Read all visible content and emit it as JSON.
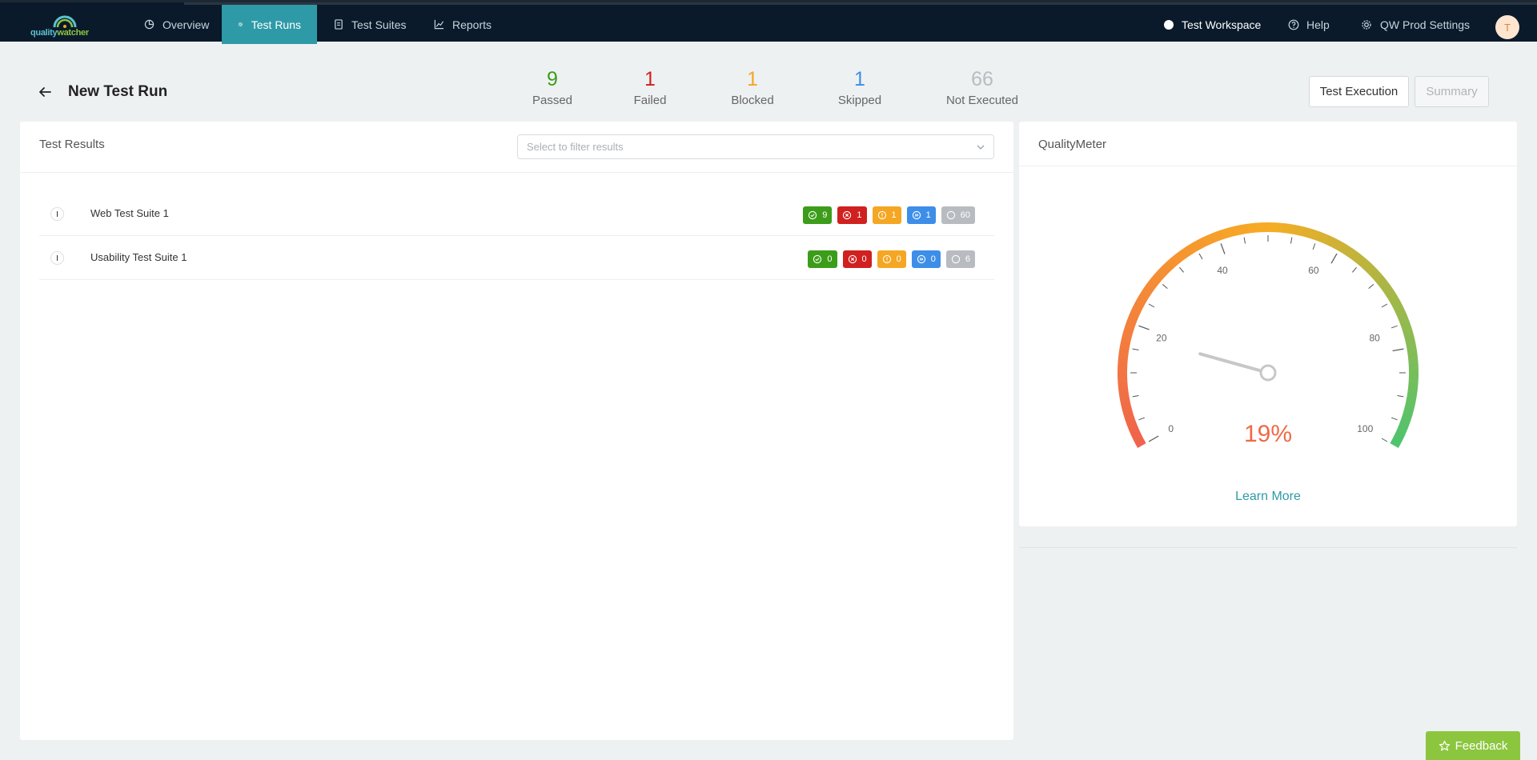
{
  "app": {
    "logo_quality": "quality",
    "logo_watcher": "watcher"
  },
  "nav": {
    "items": [
      {
        "label": "Overview",
        "icon": "pie-chart-icon"
      },
      {
        "label": "Test Runs",
        "icon": "gear-icon",
        "active": true
      },
      {
        "label": "Test Suites",
        "icon": "document-icon"
      },
      {
        "label": "Reports",
        "icon": "line-chart-icon"
      }
    ],
    "workspace": "Test Workspace",
    "help": "Help",
    "settings": "QW Prod Settings",
    "avatar_initial": "T"
  },
  "header": {
    "title": "New Test Run",
    "stats": [
      {
        "value": "9",
        "label": "Passed",
        "color": "#3c9d1a"
      },
      {
        "value": "1",
        "label": "Failed",
        "color": "#d0201f"
      },
      {
        "value": "1",
        "label": "Blocked",
        "color": "#f5a623"
      },
      {
        "value": "1",
        "label": "Skipped",
        "color": "#3d8ee8"
      },
      {
        "value": "66",
        "label": "Not Executed",
        "color": "#b8bcc0"
      }
    ],
    "btn_execution": "Test Execution",
    "btn_summary": "Summary"
  },
  "results": {
    "title": "Test Results",
    "filter_placeholder": "Select to filter results",
    "rows": [
      {
        "name": "Web Test Suite 1",
        "passed": "9",
        "failed": "1",
        "blocked": "1",
        "skipped": "1",
        "not_executed": "60"
      },
      {
        "name": "Usability Test Suite 1",
        "passed": "0",
        "failed": "0",
        "blocked": "0",
        "skipped": "0",
        "not_executed": "6"
      }
    ]
  },
  "colors": {
    "passed": "#3c9d1a",
    "failed": "#d0201f",
    "blocked": "#f5a623",
    "skipped": "#3d8ee8",
    "not_executed": "#b8bcc0",
    "accent": "#2e9aa7",
    "feedback": "#8cc63f"
  },
  "quality_meter": {
    "title": "QualityMeter",
    "value": 19,
    "value_label": "19%",
    "ticks": [
      "0",
      "20",
      "40",
      "60",
      "80",
      "100"
    ],
    "learn_more": "Learn More"
  },
  "feedback": "Feedback"
}
